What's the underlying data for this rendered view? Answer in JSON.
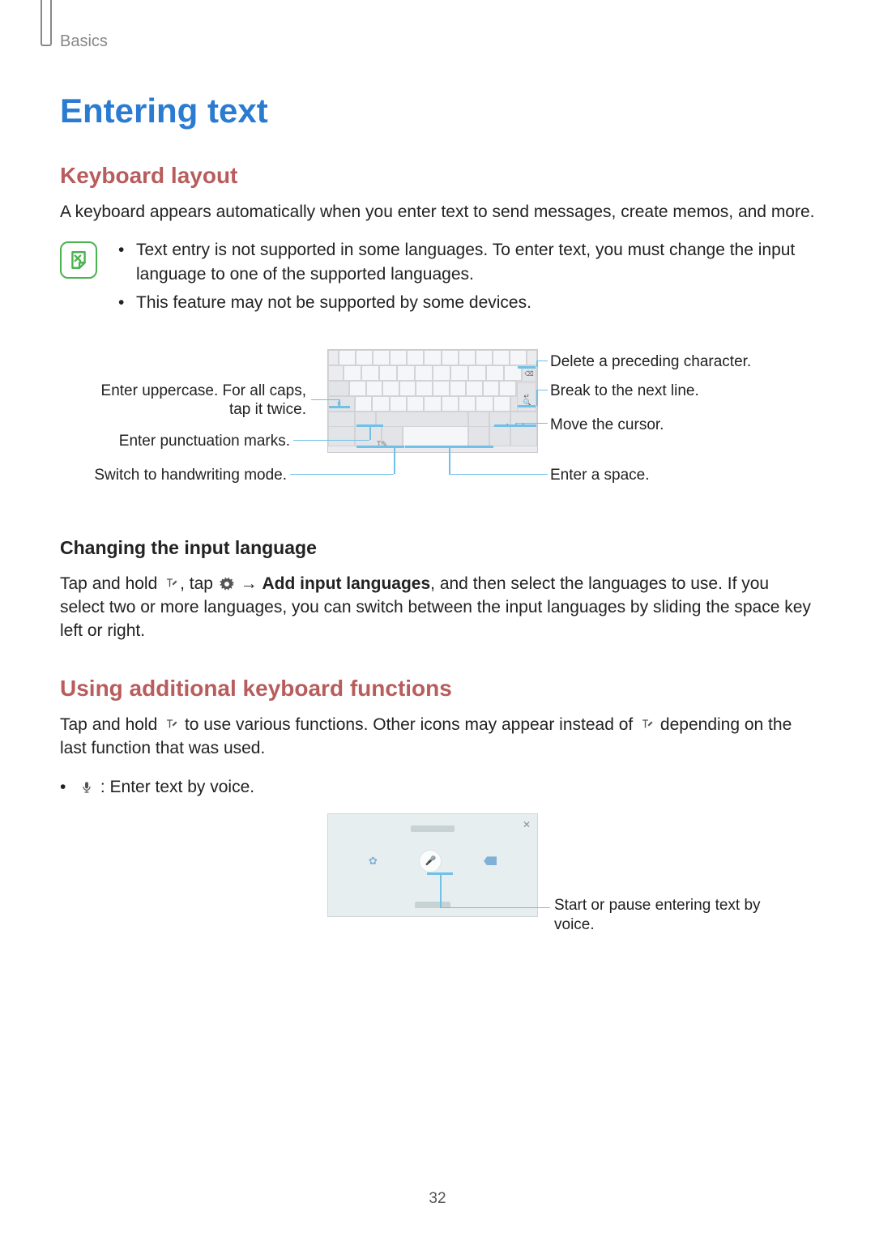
{
  "header": {
    "section": "Basics"
  },
  "title": "Entering text",
  "keyboard_layout": {
    "heading": "Keyboard layout",
    "intro": "A keyboard appears automatically when you enter text to send messages, create memos, and more.",
    "notes": [
      "Text entry is not supported in some languages. To enter text, you must change the input language to one of the supported languages.",
      "This feature may not be supported by some devices."
    ],
    "callouts": {
      "delete": "Delete a preceding character.",
      "newline": "Break to the next line.",
      "cursor": "Move the cursor.",
      "space": "Enter a space.",
      "uppercase": "Enter uppercase. For all caps, tap it twice.",
      "punctuation": "Enter punctuation marks.",
      "handwriting": "Switch to handwriting mode."
    }
  },
  "changing_lang": {
    "heading": "Changing the input language",
    "pre": "Tap and hold ",
    "mid1": ", tap ",
    "arrow": " → ",
    "bold": "Add input languages",
    "post": ", and then select the languages to use. If you select two or more languages, you can switch between the input languages by sliding the space key left or right."
  },
  "additional": {
    "heading": "Using additional keyboard functions",
    "pre": "Tap and hold ",
    "mid": " to use various functions. Other icons may appear instead of ",
    "post": " depending on the last function that was used.",
    "voice_item": " : Enter text by voice.",
    "voice_callout": "Start or pause entering text by voice."
  },
  "page_number": "32"
}
